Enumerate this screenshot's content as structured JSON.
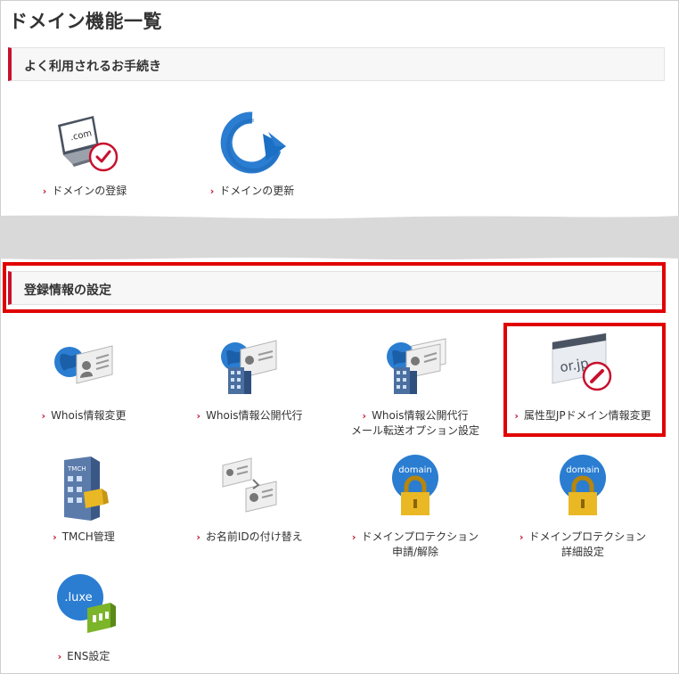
{
  "page": {
    "title": "ドメイン機能一覧"
  },
  "sections": {
    "frequent": {
      "title": "よく利用されるお手続き",
      "items": [
        {
          "label": "ドメインの登録",
          "icon": "laptop-com-check-icon"
        },
        {
          "label": "ドメインの更新",
          "icon": "renew-arrow-icon"
        }
      ]
    },
    "registration": {
      "title": "登録情報の設定",
      "items": [
        {
          "label": "Whois情報変更",
          "icon": "globe-id-card-icon"
        },
        {
          "label": "Whois情報公開代行",
          "icon": "globe-building-card-icon"
        },
        {
          "label": "Whois情報公開代行",
          "label2": "メール転送オプション設定",
          "icon": "globe-building-cards-icon"
        },
        {
          "label": "属性型JPドメイン情報変更",
          "label_prefix": "or.jp",
          "icon": "or-jp-edit-icon"
        },
        {
          "label": "TMCH管理",
          "label_prefix": "TMCH",
          "icon": "tmch-building-icon"
        },
        {
          "label": "お名前IDの付け替え",
          "icon": "id-card-swap-icon"
        },
        {
          "label": "ドメインプロテクション",
          "label2": "申請/解除",
          "badge": "domain",
          "icon": "domain-lock-icon"
        },
        {
          "label": "ドメインプロテクション",
          "label2": "詳細設定",
          "badge": "domain",
          "icon": "domain-lock-icon"
        },
        {
          "label": "ENS設定",
          "badge": ".luxe",
          "icon": "luxe-ens-icon"
        }
      ]
    }
  },
  "colors": {
    "accent": "#c8102e",
    "highlight": "#e00000",
    "globe": "#2a7dd1"
  }
}
